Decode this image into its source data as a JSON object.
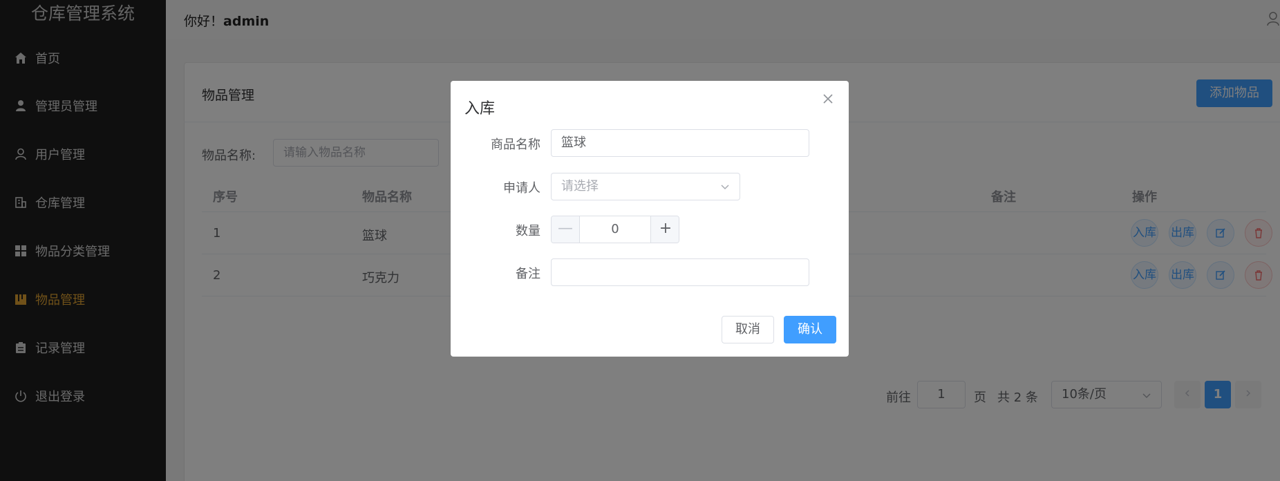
{
  "app": {
    "title": "仓库管理系统"
  },
  "sidebar": {
    "items": [
      {
        "label": "首页",
        "icon": "home-icon",
        "active": false
      },
      {
        "label": "管理员管理",
        "icon": "admin-user-icon",
        "active": false
      },
      {
        "label": "用户管理",
        "icon": "user-icon",
        "active": false
      },
      {
        "label": "仓库管理",
        "icon": "warehouse-icon",
        "active": false
      },
      {
        "label": "物品分类管理",
        "icon": "grid-icon",
        "active": false
      },
      {
        "label": "物品管理",
        "icon": "goods-icon",
        "active": true
      },
      {
        "label": "记录管理",
        "icon": "clipboard-icon",
        "active": false
      },
      {
        "label": "退出登录",
        "icon": "power-icon",
        "active": false
      }
    ]
  },
  "header": {
    "greeting": "你好！",
    "username": "admin"
  },
  "main": {
    "title": "物品管理",
    "add_button": "添加物品",
    "filter": {
      "label": "物品名称:",
      "placeholder": "请输入物品名称"
    },
    "table": {
      "columns": [
        "序号",
        "物品名称",
        "备注",
        "操作"
      ],
      "rows": [
        {
          "index": "1",
          "name": "篮球",
          "remark": ""
        },
        {
          "index": "2",
          "name": "巧克力",
          "remark": ""
        }
      ],
      "actions": {
        "in": "入库",
        "out": "出库",
        "edit_icon": "edit-icon",
        "delete_icon": "delete-icon"
      }
    },
    "pagination": {
      "goto_prefix": "前往",
      "goto_value": "1",
      "goto_suffix": "页",
      "total": "共 2 条",
      "page_size": "10条/页",
      "current_page": "1"
    }
  },
  "dialog": {
    "title": "入库",
    "fields": {
      "product_name": {
        "label": "商品名称",
        "value": "篮球"
      },
      "applicant": {
        "label": "申请人",
        "placeholder": "请选择"
      },
      "quantity": {
        "label": "数量",
        "value": "0",
        "minus": "—",
        "plus": "+"
      },
      "remark": {
        "label": "备注",
        "value": ""
      }
    },
    "cancel": "取消",
    "confirm": "确认"
  },
  "colors": {
    "primary": "#409eff",
    "danger": "#f56c6c",
    "sidebar_bg": "#1f1f1f",
    "active_menu": "#e0a332"
  }
}
